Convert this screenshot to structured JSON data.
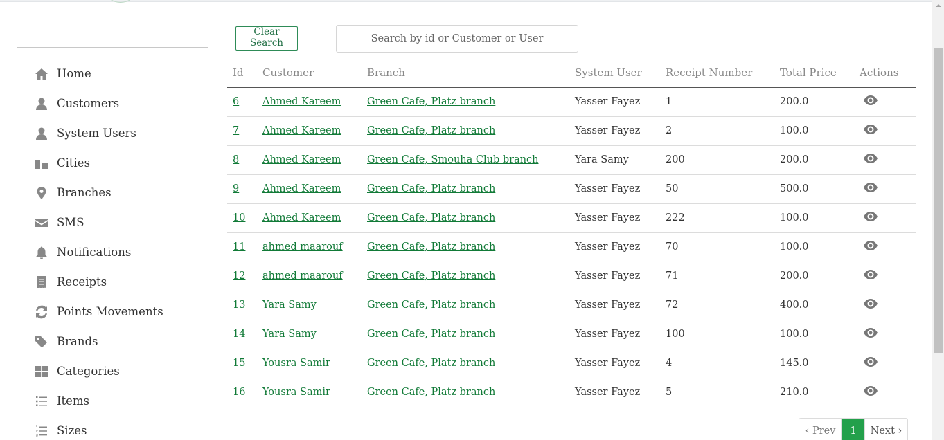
{
  "search": {
    "clear_label": "Clear Search",
    "placeholder": "Search by id or Customer or User",
    "value": ""
  },
  "sidebar": {
    "items": [
      {
        "label": "Home",
        "icon": "home-icon"
      },
      {
        "label": "Customers",
        "icon": "user-icon"
      },
      {
        "label": "System Users",
        "icon": "user-tie-icon"
      },
      {
        "label": "Cities",
        "icon": "building-icon"
      },
      {
        "label": "Branches",
        "icon": "map-marker-icon"
      },
      {
        "label": "SMS",
        "icon": "envelope-icon"
      },
      {
        "label": "Notifications",
        "icon": "bell-icon"
      },
      {
        "label": "Receipts",
        "icon": "receipt-icon"
      },
      {
        "label": "Points Movements",
        "icon": "refresh-icon"
      },
      {
        "label": "Brands",
        "icon": "tag-icon"
      },
      {
        "label": "Categories",
        "icon": "grid-icon"
      },
      {
        "label": "Items",
        "icon": "list-icon"
      },
      {
        "label": "Sizes",
        "icon": "list-ol-icon"
      }
    ]
  },
  "table": {
    "headers": [
      "Id",
      "Customer",
      "Branch",
      "System User",
      "Receipt Number",
      "Total Price",
      "Actions"
    ],
    "rows": [
      {
        "id": "6",
        "customer": "Ahmed Kareem",
        "branch": "Green Cafe, Platz branch",
        "user": "Yasser Fayez",
        "receipt": "1",
        "total": "200.0"
      },
      {
        "id": "7",
        "customer": "Ahmed Kareem",
        "branch": "Green Cafe, Platz branch",
        "user": "Yasser Fayez",
        "receipt": "2",
        "total": "100.0"
      },
      {
        "id": "8",
        "customer": "Ahmed Kareem",
        "branch": "Green Cafe, Smouha Club branch",
        "user": "Yara Samy",
        "receipt": "200",
        "total": "200.0"
      },
      {
        "id": "9",
        "customer": "Ahmed Kareem",
        "branch": "Green Cafe, Platz branch",
        "user": "Yasser Fayez",
        "receipt": "50",
        "total": "500.0"
      },
      {
        "id": "10",
        "customer": "Ahmed Kareem",
        "branch": "Green Cafe, Platz branch",
        "user": "Yasser Fayez",
        "receipt": "222",
        "total": "100.0"
      },
      {
        "id": "11",
        "customer": "ahmed maarouf",
        "branch": "Green Cafe, Platz branch",
        "user": "Yasser Fayez",
        "receipt": "70",
        "total": "100.0"
      },
      {
        "id": "12",
        "customer": "ahmed maarouf",
        "branch": "Green Cafe, Platz branch",
        "user": "Yasser Fayez",
        "receipt": "71",
        "total": "200.0"
      },
      {
        "id": "13",
        "customer": "Yara Samy",
        "branch": "Green Cafe, Platz branch",
        "user": "Yasser Fayez",
        "receipt": "72",
        "total": "400.0"
      },
      {
        "id": "14",
        "customer": "Yara Samy",
        "branch": "Green Cafe, Platz branch",
        "user": "Yasser Fayez",
        "receipt": "100",
        "total": "100.0"
      },
      {
        "id": "15",
        "customer": "Yousra Samir",
        "branch": "Green Cafe, Platz branch",
        "user": "Yasser Fayez",
        "receipt": "4",
        "total": "145.0"
      },
      {
        "id": "16",
        "customer": "Yousra Samir",
        "branch": "Green Cafe, Platz branch",
        "user": "Yasser Fayez",
        "receipt": "5",
        "total": "210.0"
      }
    ],
    "action_icon": "eye-icon"
  },
  "pagination": {
    "prev_label": "‹ Prev",
    "current": "1",
    "next_label": "Next ›"
  },
  "colors": {
    "accent": "#23a04b",
    "link": "#117a37",
    "icon": "#888888"
  }
}
